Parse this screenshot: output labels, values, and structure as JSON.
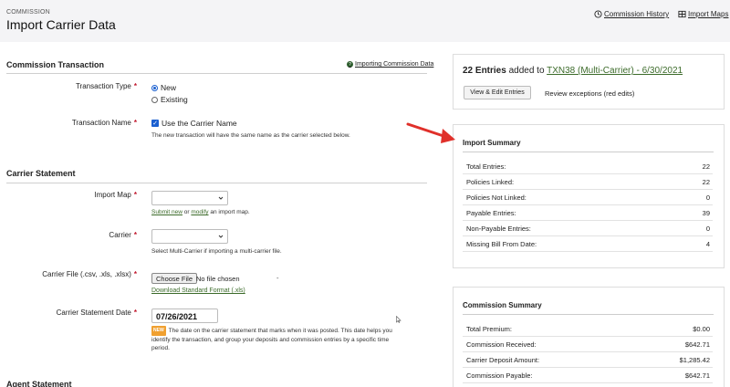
{
  "header": {
    "breadcrumb": "COMMISSION",
    "title": "Import Carrier Data",
    "links": {
      "history": "Commission History",
      "maps": "Import Maps"
    }
  },
  "commission_transaction": {
    "title": "Commission Transaction",
    "help_link": "Importing Commission Data",
    "transaction_type": {
      "label": "Transaction Type",
      "options": [
        "New",
        "Existing"
      ],
      "selected": "New"
    },
    "transaction_name": {
      "label": "Transaction Name",
      "checkbox_label": "Use the Carrier Name",
      "hint": "The new transaction will have the same name as the carrier selected below."
    }
  },
  "carrier_statement": {
    "title": "Carrier Statement",
    "import_map": {
      "label": "Import Map",
      "hint_link1": "Submit new",
      "hint_or": " or ",
      "hint_link2": "modify",
      "hint_rest": " an import map."
    },
    "carrier": {
      "label": "Carrier",
      "hint": "Select Multi-Carrier if importing a multi-carrier file."
    },
    "carrier_file": {
      "label": "Carrier File (.csv, .xls, .xlsx)",
      "button": "Choose File",
      "status": "No file chosen",
      "dash": "-",
      "download": "Download Standard Format (.xls)"
    },
    "statement_date": {
      "label": "Carrier Statement Date",
      "value": "07/26/2021",
      "badge": "NEW",
      "hint": "The date on the carrier statement that marks when it was posted. This date helps you identify the transaction, and group your deposits and commission entries by a specific time period."
    }
  },
  "agent_statement": {
    "title": "Agent Statement"
  },
  "entries_panel": {
    "count": "22 Entries",
    "added_to": " added to ",
    "link": "TXN38 (Multi-Carrier) - 6/30/2021",
    "button": "View & Edit Entries",
    "review": "Review exceptions (red edits)"
  },
  "import_summary": {
    "title": "Import Summary",
    "rows": [
      {
        "label": "Total Entries:",
        "value": "22"
      },
      {
        "label": "Policies Linked:",
        "value": "22"
      },
      {
        "label": "Policies Not Linked:",
        "value": "0"
      },
      {
        "label": "Payable Entries:",
        "value": "39"
      },
      {
        "label": "Non-Payable Entries:",
        "value": "0"
      },
      {
        "label": "Missing Bill From Date:",
        "value": "4"
      }
    ]
  },
  "commission_summary": {
    "title": "Commission Summary",
    "rows": [
      {
        "label": "Total Premium:",
        "value": "$0.00"
      },
      {
        "label": "Commission Received:",
        "value": "$642.71"
      },
      {
        "label": "Carrier Deposit Amount:",
        "value": "$1,285.42"
      },
      {
        "label": "Commission Payable:",
        "value": "$642.71"
      }
    ]
  },
  "colors": {
    "accent_link": "#3c6b2a",
    "required": "#c0142a",
    "annotation_arrow": "#e0302a"
  }
}
